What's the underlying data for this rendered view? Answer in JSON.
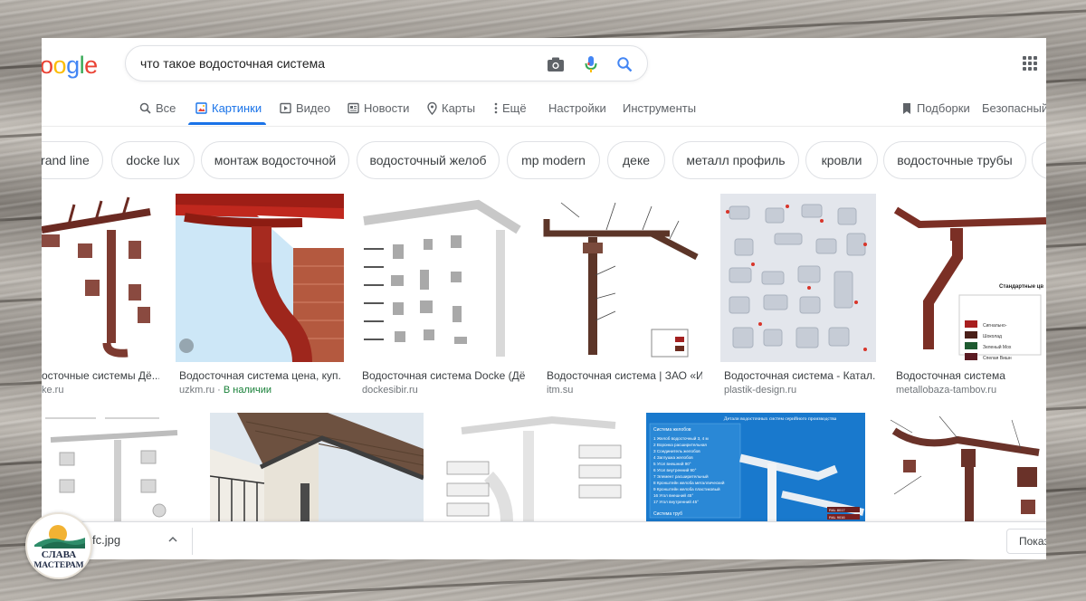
{
  "search": {
    "query": "что такое водосточная система"
  },
  "logo": {
    "letters": [
      "o",
      "o",
      "g",
      "l",
      "e"
    ],
    "colors": [
      "#ea4335",
      "#fbbc05",
      "#4285f4",
      "#34a853",
      "#ea4335"
    ]
  },
  "tabs": [
    {
      "label": "Все",
      "icon": "search-icon"
    },
    {
      "label": "Картинки",
      "icon": "image-icon",
      "active": true
    },
    {
      "label": "Видео",
      "icon": "video-icon"
    },
    {
      "label": "Новости",
      "icon": "news-icon"
    },
    {
      "label": "Карты",
      "icon": "map-pin-icon"
    },
    {
      "label": "Ещё",
      "icon": "more-vert-icon"
    },
    {
      "label": "Настройки"
    },
    {
      "label": "Инструменты"
    }
  ],
  "right_links": {
    "collections": "Подборки",
    "safesearch": "Безопасный"
  },
  "chips": [
    "grand line",
    "docke lux",
    "монтаж водосточной",
    "водосточный желоб",
    "mp modern",
    "деке",
    "металл профиль",
    "кровли",
    "водосточные трубы"
  ],
  "results_row1": [
    {
      "caption": "осточные системы Дё...",
      "source": "ke.ru",
      "badge": ""
    },
    {
      "caption": "Водосточная система цена, куп...",
      "source": "uzkm.ru",
      "badge": "В наличии"
    },
    {
      "caption": "Водосточная система Docke (Дё...",
      "source": "dockesibir.ru",
      "badge": ""
    },
    {
      "caption": "Водосточная система | ЗАО «И...",
      "source": "itm.su",
      "badge": ""
    },
    {
      "caption": "Водосточная система - Катал...",
      "source": "plastik-design.ru",
      "badge": ""
    },
    {
      "caption": "Водосточная система",
      "source": "metallobaza-tambov.ru",
      "badge": ""
    }
  ],
  "thumb_text": {
    "blue_title": "Детали водосточных систем серийного производства",
    "blue_list_head": "Система желобов",
    "blue_items": [
      "1 Желоб водосточный 3, 4 м",
      "2 Воронка расширительная",
      "3 Соединитель желобов",
      "4 Заглушка желобов",
      "5 Угол внешний 90°",
      "6 Угол внутренний 90°",
      "7 Элемент расширительный",
      "8 Кронштейн желоба металлический",
      "9 Кронштейн желоба пластиковый",
      "16 Угол внешний 45°",
      "17 Угол внутренний 45°"
    ],
    "blue_foot": "Система труб",
    "ral_1": "RAL 8017",
    "ral_2": "RAL 9016",
    "std_title": "Стандартные цв",
    "std_items": [
      "Сигнально-",
      "Шоколад",
      "Зеленый Мох",
      "Спелая Вишн"
    ]
  },
  "download": {
    "file": "fc.jpg",
    "show_all": "Показ"
  },
  "brand": {
    "line1": "СЛАВА",
    "line2": "МАСТЕРАМ"
  }
}
